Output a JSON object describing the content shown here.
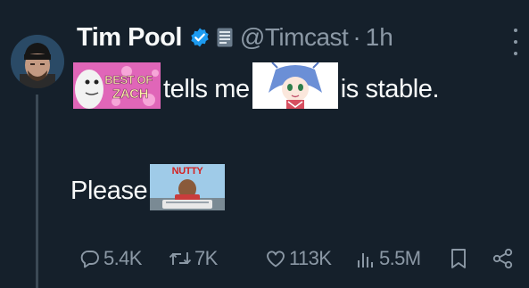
{
  "author": {
    "name": "Tim Pool",
    "handle": "@Timcast",
    "separator": "·",
    "time": "1h"
  },
  "tweet": {
    "line1": {
      "word1": "tells me",
      "word2": "is stable."
    },
    "line2": {
      "word1": "Please"
    },
    "emoji_images": [
      {
        "name": "best-of-zach-image",
        "text": "BEST OF ZACH"
      },
      {
        "name": "anime-character-image"
      },
      {
        "name": "nutty-movie-image",
        "text": "NUTTY"
      }
    ]
  },
  "actions": {
    "reply_count": "5.4K",
    "retweet_count": "7K",
    "like_count": "113K",
    "views_count": "5.5M"
  },
  "colors": {
    "background": "#15202b",
    "text": "#f7f9f9",
    "secondary": "#8b98a5",
    "verified": "#1d9bf0"
  },
  "icons": [
    "verified-icon",
    "affiliate-badge-icon",
    "more-icon",
    "reply-icon",
    "retweet-icon",
    "like-icon",
    "views-icon",
    "bookmark-icon",
    "share-icon"
  ]
}
